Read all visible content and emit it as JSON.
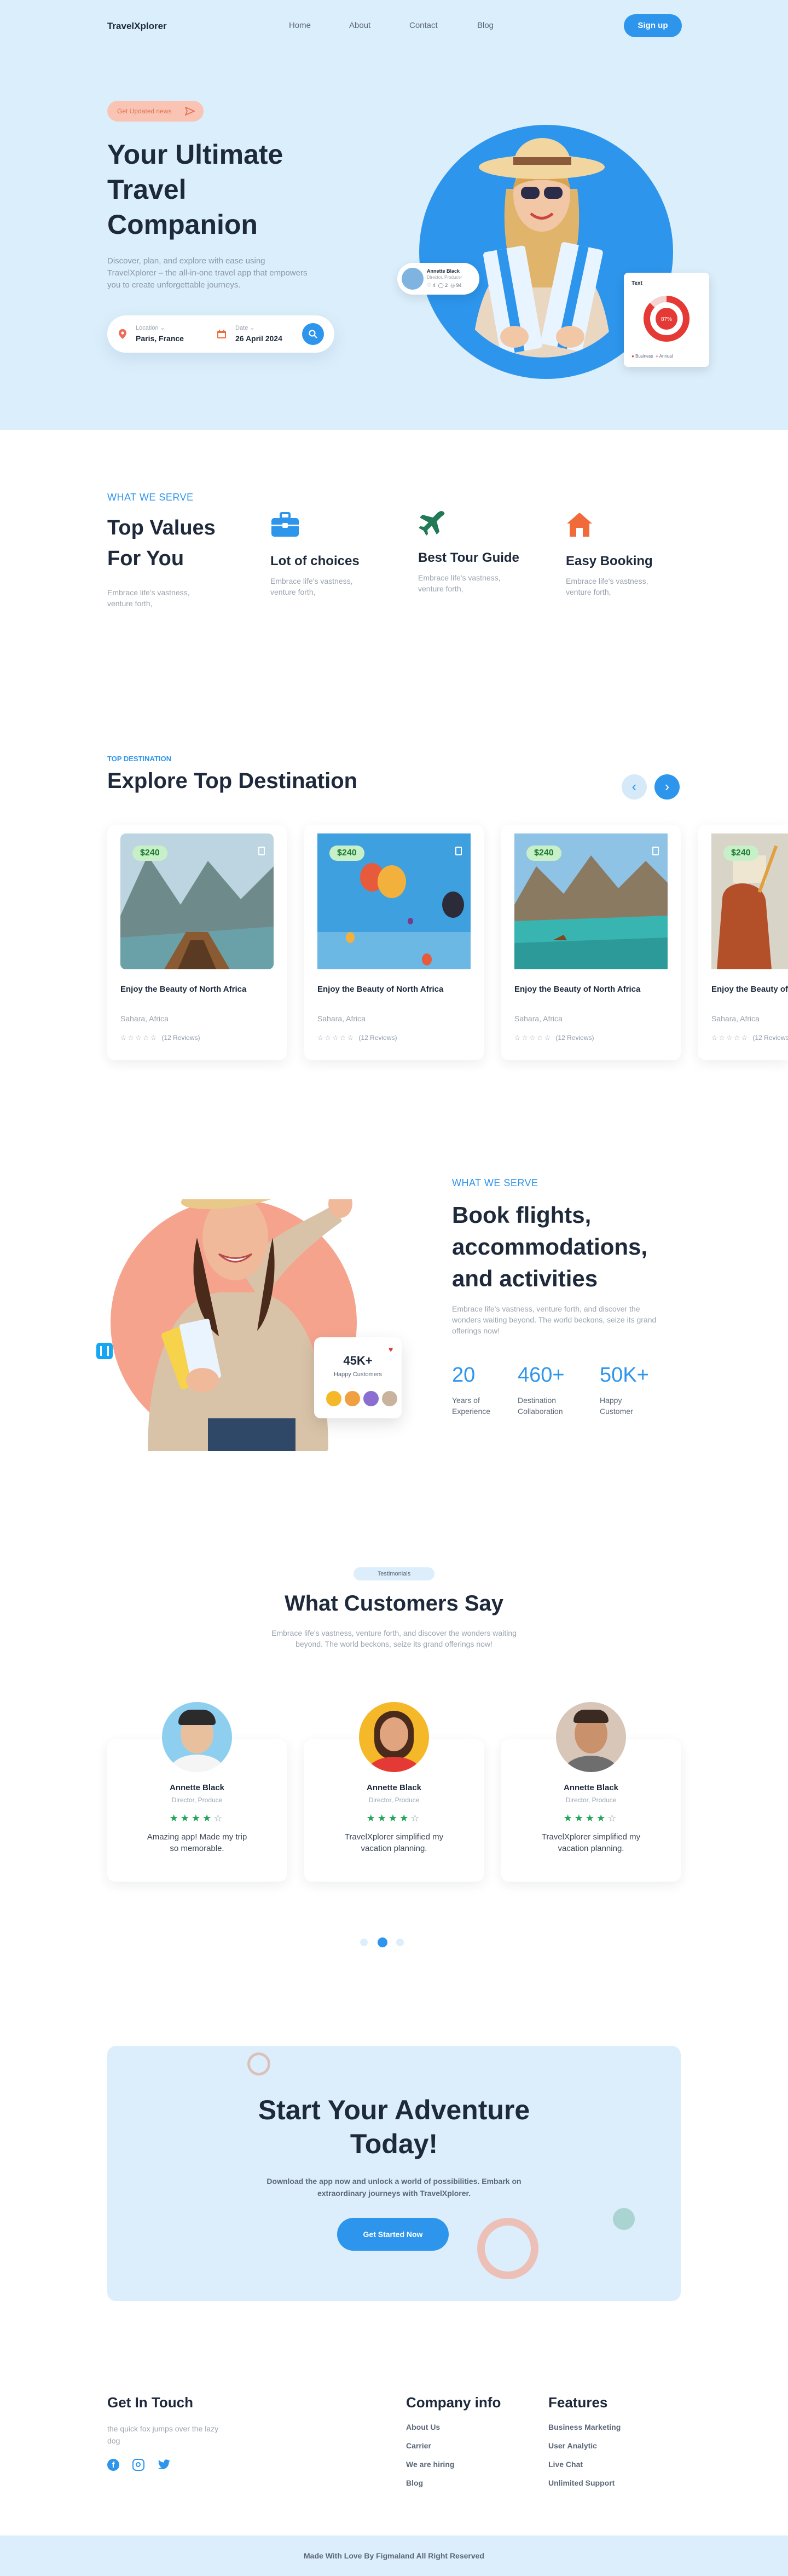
{
  "nav": {
    "logo": "TravelXplorer",
    "links": [
      "Home",
      "About",
      "Contact",
      "Blog"
    ],
    "signup": "Sign up"
  },
  "hero": {
    "badge": "Get Updated news",
    "title": "Your Ultimate Travel Companion",
    "subtitle": "Discover, plan, and explore with ease using TravelXplorer – the all-in-one travel app that empowers you to create unforgettable journeys.",
    "location_label": "Location",
    "location_value": "Paris, France",
    "date_label": "Date",
    "date_value": "26 April 2024",
    "profile_name": "Annette Black",
    "profile_role": "Director, Producer",
    "profile_stats": [
      "4",
      "2",
      "94"
    ],
    "chart_label": "Text",
    "chart_center": "87%",
    "chart_legend": [
      "Business",
      "Annual"
    ]
  },
  "values": {
    "kicker": "WHAT WE SERVE",
    "title": "Top Values For You",
    "desc": "Embrace life's vastness, venture forth,",
    "items": [
      {
        "title": "Lot of choices",
        "desc": "Embrace life's vastness, venture forth,",
        "icon": "briefcase-icon",
        "color": "#2d95ec"
      },
      {
        "title": "Best Tour Guide",
        "desc": "Embrace life's vastness, venture forth,",
        "icon": "airplane-icon",
        "color": "#1f7a55"
      },
      {
        "title": "Easy Booking",
        "desc": "Embrace life's vastness, venture forth,",
        "icon": "home-icon",
        "color": "#f06a3a"
      }
    ]
  },
  "destinations": {
    "kicker": "TOP DESTINATION",
    "title": "Explore Top Destination",
    "cards": [
      {
        "price": "$240",
        "title": "Enjoy the Beauty of North Africa",
        "location": "Sahara, Africa",
        "reviews": "(12 Reviews)"
      },
      {
        "price": "$240",
        "title": "Enjoy the Beauty of North Africa",
        "location": "Sahara, Africa",
        "reviews": "(12 Reviews)"
      },
      {
        "price": "$240",
        "title": "Enjoy the Beauty of North Africa",
        "location": "Sahara, Africa",
        "reviews": "(12 Reviews)"
      },
      {
        "price": "$240",
        "title": "Enjoy the Beauty of North Africa",
        "location": "Sahara, Africa",
        "reviews": "(12 Reviews)"
      }
    ]
  },
  "booking": {
    "kicker": "WHAT WE SERVE",
    "title": "Book flights, accommodations, and activities",
    "desc": "Embrace life's vastness, venture forth, and discover the wonders waiting beyond. The world beckons, seize its grand offerings now!",
    "stats": [
      {
        "value": "20",
        "label": "Years of Experience"
      },
      {
        "value": "460+",
        "label": "Destination Collaboration"
      },
      {
        "value": "50K+",
        "label": "Happy Customer"
      }
    ],
    "customers_value": "45K+",
    "customers_label": "Happy Customers"
  },
  "testimonials": {
    "badge": "Testimonials",
    "title": "What Customers Say",
    "desc": "Embrace life's vastness, venture forth, and discover the wonders waiting beyond. The world beckons, seize its grand offerings now!",
    "items": [
      {
        "name": "Annette Black",
        "role": "Director, Produce",
        "quote": "Amazing app! Made my trip so memorable.",
        "avatar_bg": "#8ecff0",
        "rating": 4
      },
      {
        "name": "Annette Black",
        "role": "Director, Produce",
        "quote": "TravelXplorer simplified my vacation planning.",
        "avatar_bg": "#f5b829",
        "rating": 4
      },
      {
        "name": "Annette Black",
        "role": "Director, Produce",
        "quote": "TravelXplorer simplified my vacation planning.",
        "avatar_bg": "#d8c7b8",
        "rating": 4
      }
    ]
  },
  "cta": {
    "title": "Start Your Adventure Today!",
    "desc": "Download the app now and unlock a world of possibilities. Embark on extraordinary journeys with TravelXplorer.",
    "button": "Get Started Now"
  },
  "footer": {
    "touch_title": "Get In Touch",
    "touch_desc": "the quick fox jumps over the lazy dog",
    "company_title": "Company info",
    "company_links": [
      "About Us",
      "Carrier",
      "We are hiring",
      "Blog"
    ],
    "features_title": "Features",
    "features_links": [
      "Business Marketing",
      "User Analytic",
      "Live Chat",
      "Unlimited Support"
    ],
    "copyright": "Made With Love By Figmaland All Right Reserved"
  },
  "colors": {
    "accent": "#2d95ec",
    "hero_bg": "#dbeefb",
    "price_bg": "#c8f0c8",
    "coral": "#f5a38d"
  }
}
